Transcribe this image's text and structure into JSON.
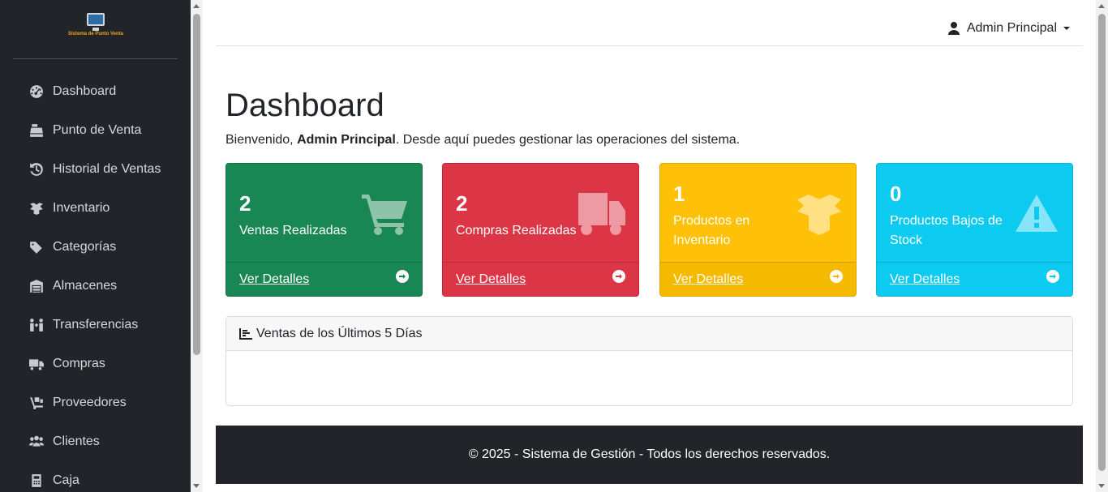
{
  "sidebar": {
    "logo_text": "Sistema de Punto Venta",
    "items": [
      {
        "label": "Dashboard",
        "icon": "gauge-icon"
      },
      {
        "label": "Punto de Venta",
        "icon": "cash-register-icon"
      },
      {
        "label": "Historial de Ventas",
        "icon": "history-icon"
      },
      {
        "label": "Inventario",
        "icon": "boxes-icon"
      },
      {
        "label": "Categorías",
        "icon": "tags-icon"
      },
      {
        "label": "Almacenes",
        "icon": "warehouse-icon"
      },
      {
        "label": "Transferencias",
        "icon": "people-arrows-icon"
      },
      {
        "label": "Compras",
        "icon": "truck-icon"
      },
      {
        "label": "Proveedores",
        "icon": "dolly-icon"
      },
      {
        "label": "Clientes",
        "icon": "users-icon"
      },
      {
        "label": "Caja",
        "icon": "calculator-icon"
      }
    ]
  },
  "header": {
    "user_name": "Admin Principal"
  },
  "main": {
    "title": "Dashboard",
    "welcome_prefix": "Bienvenido, ",
    "welcome_user": "Admin Principal",
    "welcome_suffix": ". Desde aquí puedes gestionar las operaciones del sistema.",
    "cards": [
      {
        "value": "2",
        "label": "Ventas Realizadas",
        "link": "Ver Detalles",
        "icon": "shopping-cart-icon",
        "color": "#198754"
      },
      {
        "value": "2",
        "label": "Compras Realizadas",
        "link": "Ver Detalles",
        "icon": "truck-icon",
        "color": "#dc3545"
      },
      {
        "value": "1",
        "label": "Productos en Inventario",
        "link": "Ver Detalles",
        "icon": "box-open-icon",
        "color": "#ffc107"
      },
      {
        "value": "0",
        "label": "Productos Bajos de Stock",
        "link": "Ver Detalles",
        "icon": "warning-icon",
        "color": "#0dcaf0"
      }
    ],
    "chart_panel": {
      "title": "Ventas de los Últimos 5 Días",
      "icon": "chart-bar-icon"
    }
  },
  "footer": {
    "text": "© 2025 - Sistema de Gestión - Todos los derechos reservados."
  }
}
